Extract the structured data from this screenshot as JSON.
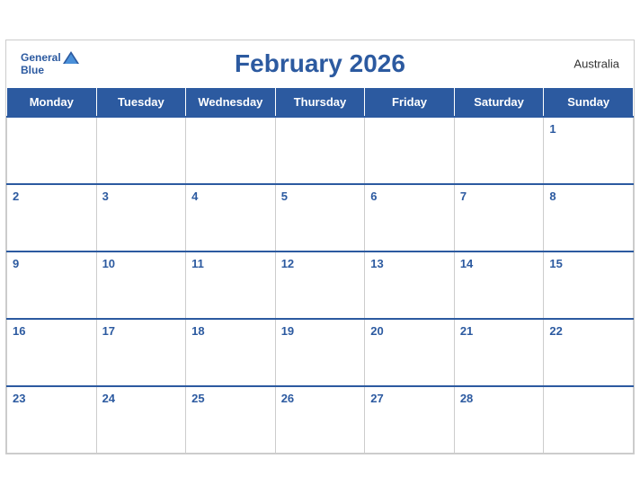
{
  "header": {
    "title": "February 2026",
    "country": "Australia",
    "logo": {
      "general": "General",
      "blue": "Blue"
    }
  },
  "weekdays": [
    "Monday",
    "Tuesday",
    "Wednesday",
    "Thursday",
    "Friday",
    "Saturday",
    "Sunday"
  ],
  "weeks": [
    [
      null,
      null,
      null,
      null,
      null,
      null,
      1
    ],
    [
      2,
      3,
      4,
      5,
      6,
      7,
      8
    ],
    [
      9,
      10,
      11,
      12,
      13,
      14,
      15
    ],
    [
      16,
      17,
      18,
      19,
      20,
      21,
      22
    ],
    [
      23,
      24,
      25,
      26,
      27,
      28,
      null
    ]
  ]
}
